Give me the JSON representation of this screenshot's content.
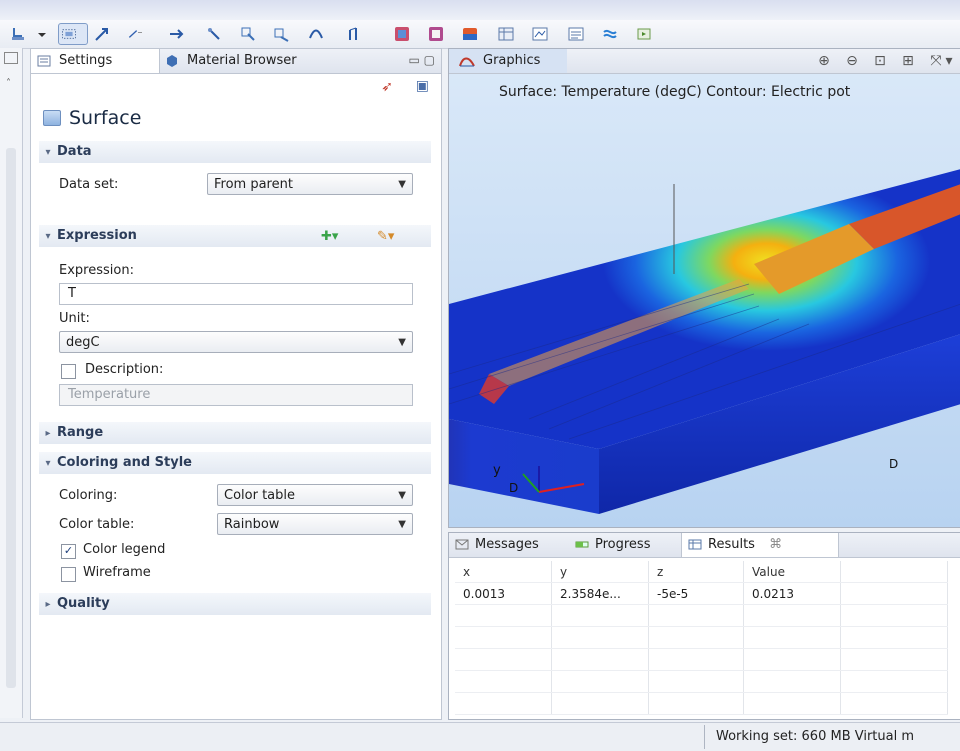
{
  "toolbar": {
    "icons": [
      "paint-bucket-icon",
      "select-icon",
      "arrow-icon",
      "zoom-tool-icon",
      "pan-icon",
      "rotate-icon",
      "move-icon",
      "geometry-icon",
      "mesh-icon",
      "study-icon",
      "plot-icon",
      "table-icon",
      "export-icon",
      "report-icon",
      "settings-icon"
    ]
  },
  "settings": {
    "tabs": [
      {
        "label": "Settings"
      },
      {
        "label": "Material Browser"
      }
    ],
    "title": "Surface",
    "sections": {
      "data": "Data",
      "expression": "Expression",
      "range": "Range",
      "coloring": "Coloring and Style",
      "quality": "Quality"
    },
    "data_set_label": "Data set:",
    "data_set_value": "From parent",
    "expression_label": "Expression:",
    "expression_value": "T",
    "unit_label": "Unit:",
    "unit_value": "degC",
    "description_label": "Description:",
    "description_value": "Temperature",
    "description_checked": false,
    "coloring_label": "Coloring:",
    "coloring_value": "Color table",
    "color_table_label": "Color table:",
    "color_table_value": "Rainbow",
    "color_legend_label": "Color legend",
    "color_legend_checked": true,
    "wireframe_label": "Wireframe",
    "wireframe_checked": false
  },
  "graphics": {
    "tab": "Graphics",
    "plot_title": "Surface: Temperature (degC) Contour: Electric pot",
    "axis_y": "y",
    "axis_d1": "D",
    "axis_d2": "D"
  },
  "results": {
    "tabs": [
      {
        "label": "Messages"
      },
      {
        "label": "Progress"
      },
      {
        "label": "Results"
      }
    ],
    "close_glyph": "⌘",
    "columns": [
      "x",
      "y",
      "z",
      "Value"
    ],
    "rows": [
      [
        "0.0013",
        "2.3584e...",
        "-5e-5",
        "0.0213"
      ]
    ]
  },
  "status": {
    "text": "Working set: 660 MB  Virtual m"
  },
  "colors": {
    "accent": "#2c3d5a",
    "selection": "#dce6f6"
  }
}
